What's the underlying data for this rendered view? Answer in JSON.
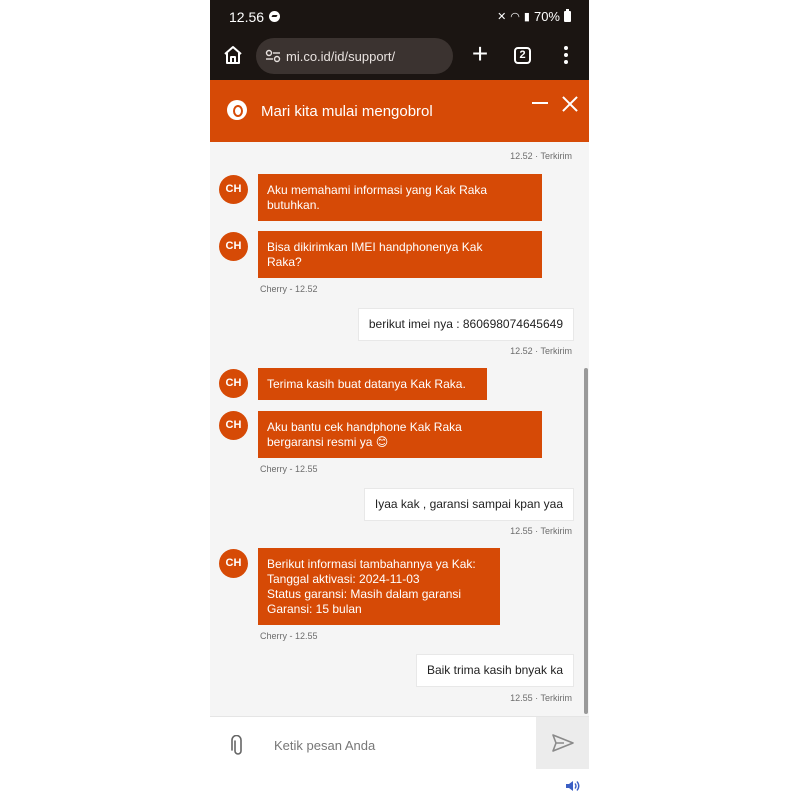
{
  "status_bar": {
    "time": "12.56",
    "battery": "70%"
  },
  "browser": {
    "url": "mi.co.id/id/support/",
    "tab_count": "2"
  },
  "chat_header": {
    "title": "Mari kita mulai mengobrol"
  },
  "messages": [
    {
      "meta": "12.52 · Terkirim"
    },
    {
      "avatar": "CH",
      "text_lines": [
        "Aku memahami informasi yang Kak Raka",
        "butuhkan."
      ]
    },
    {
      "avatar": "CH",
      "text_lines": [
        "Bisa dikirimkan IMEI handphonenya Kak",
        "Raka?"
      ],
      "meta": "Cherry - 12.52"
    },
    {
      "text": "berikut imei nya : 860698074645649",
      "meta": "12.52 · Terkirim"
    },
    {
      "avatar": "CH",
      "text_lines": [
        "Terima kasih buat datanya Kak Raka."
      ]
    },
    {
      "avatar": "CH",
      "text_lines": [
        "Aku bantu cek handphone Kak Raka",
        "bergaransi resmi ya 😊"
      ],
      "meta": "Cherry - 12.55"
    },
    {
      "text": "Iyaa kak , garansi sampai kpan yaa",
      "meta": "12.55 · Terkirim"
    },
    {
      "avatar": "CH",
      "text_lines": [
        "Berikut informasi tambahannya ya Kak:",
        "Tanggal aktivasi: 2024-11-03",
        "Status garansi: Masih dalam garansi",
        "Garansi: 15 bulan"
      ],
      "meta": "Cherry - 12.55"
    },
    {
      "text": "Baik trima kasih bnyak ka",
      "meta": "12.55 · Terkirim"
    }
  ],
  "input": {
    "placeholder": "Ketik pesan Anda"
  },
  "colors": {
    "accent": "#d64a06",
    "statusbar": "#1b1512"
  },
  "icons": [
    "messenger-icon",
    "mute-icon",
    "wifi-icon",
    "signal-icon",
    "battery-icon",
    "home-icon",
    "site-settings-icon",
    "plus-icon",
    "tabs-icon",
    "more-menu-icon",
    "chat-support-icon",
    "minimize-icon",
    "close-icon",
    "attach-icon",
    "send-icon",
    "speaker-icon"
  ]
}
